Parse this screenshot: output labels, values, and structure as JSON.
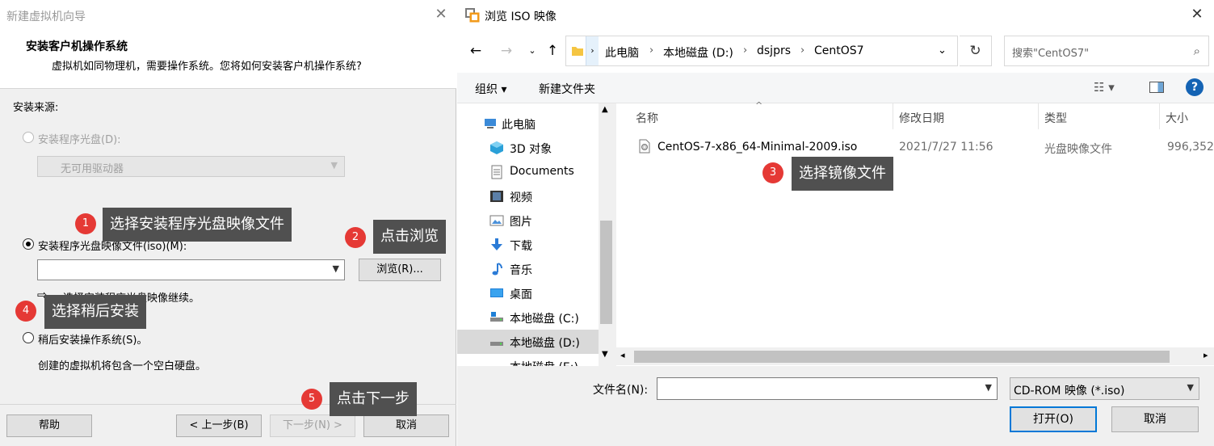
{
  "wizard": {
    "title": "新建虚拟机向导",
    "header_title": "安装客户机操作系统",
    "header_desc": "虚拟机如同物理机，需要操作系统。您将如何安装客户机操作系统?",
    "source_label": "安装来源:",
    "option_disc_label": "安装程序光盘(D):",
    "drive_value": "无可用驱动器",
    "option_iso_label": "安装程序光盘映像文件(iso)(M):",
    "iso_value": "",
    "browse_label": "浏览(R)...",
    "iso_hint": "选择安装程序光盘映像继续。",
    "option_later_label": "稍后安装操作系统(S)。",
    "later_desc": "创建的虚拟机将包含一个空白硬盘。",
    "buttons": {
      "help": "帮助",
      "back": "< 上一步(B)",
      "next": "下一步(N) >",
      "cancel": "取消"
    },
    "selected_option": "iso"
  },
  "annotations": [
    {
      "num": "1",
      "text": "选择安装程序光盘映像文件"
    },
    {
      "num": "2",
      "text": "点击浏览"
    },
    {
      "num": "3",
      "text": "选择镜像文件"
    },
    {
      "num": "4",
      "text": "选择稍后安装"
    },
    {
      "num": "5",
      "text": "点击下一步"
    }
  ],
  "browse": {
    "title": "浏览 ISO 映像",
    "breadcrumb": [
      "此电脑",
      "本地磁盘 (D:)",
      "dsjprs",
      "CentOS7"
    ],
    "search_placeholder": "搜索\"CentOS7\"",
    "toolbar": {
      "organize": "组织 ▾",
      "new_folder": "新建文件夹"
    },
    "nav_items": [
      {
        "label": "此电脑",
        "icon": "computer-icon"
      },
      {
        "label": "3D 对象",
        "icon": "cube-icon"
      },
      {
        "label": "Documents",
        "icon": "document-icon"
      },
      {
        "label": "视频",
        "icon": "video-icon"
      },
      {
        "label": "图片",
        "icon": "picture-icon"
      },
      {
        "label": "下载",
        "icon": "download-icon"
      },
      {
        "label": "音乐",
        "icon": "music-icon"
      },
      {
        "label": "桌面",
        "icon": "desktop-icon"
      },
      {
        "label": "本地磁盘 (C:)",
        "icon": "drive-icon"
      },
      {
        "label": "本地磁盘 (D:)",
        "icon": "drive-icon",
        "selected": true
      },
      {
        "label": "本地磁盘 (E:)",
        "icon": "drive-icon"
      }
    ],
    "columns": [
      "名称",
      "修改日期",
      "类型",
      "大小"
    ],
    "files": [
      {
        "name": "CentOS-7-x86_64-Minimal-2009.iso",
        "modified": "2021/7/27 11:56",
        "type": "光盘映像文件",
        "size": "996,352"
      }
    ],
    "filename_label": "文件名(N):",
    "filename_value": "",
    "filetype_value": "CD-ROM 映像 (*.iso)",
    "open_label": "打开(O)",
    "cancel_label": "取消"
  }
}
